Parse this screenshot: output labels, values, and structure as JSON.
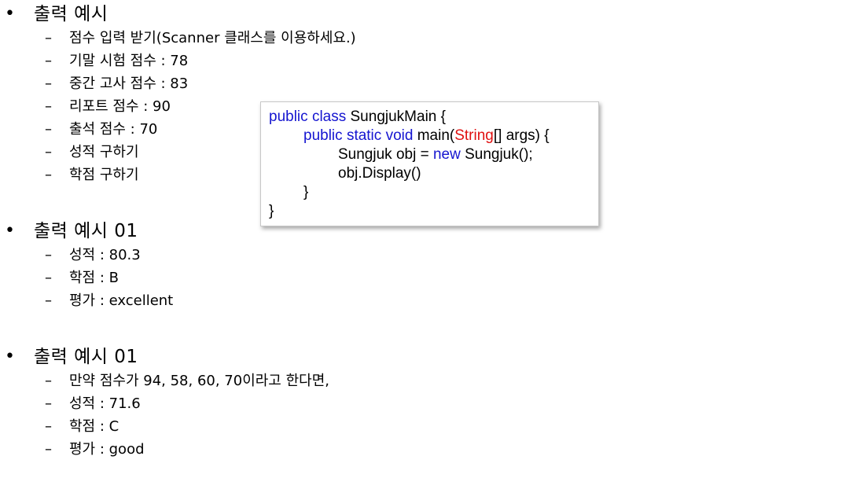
{
  "sections": [
    {
      "heading": "출력 예시",
      "items": [
        "점수 입력 받기(Scanner 클래스를 이용하세요.)",
        "기말 시험 점수 : 78",
        "중간 고사 점수 : 83",
        "리포트 점수 : 90",
        "출석 점수 : 70",
        "성적 구하기",
        "학점 구하기"
      ]
    },
    {
      "heading": "출력 예시 01",
      "items": [
        "성적 : 80.3",
        "학점 : B",
        "평가 : excellent"
      ]
    },
    {
      "heading": "출력 예시 01",
      "items": [
        "만약 점수가 94, 58, 60, 70이라고 한다면,",
        "성적 : 71.6",
        "학점 : C",
        "평가 : good"
      ]
    }
  ],
  "bullet_symbol": "•",
  "dash_symbol": "–",
  "code": {
    "line1_kw1": "public",
    "line1_kw2": "class",
    "line1_rest": " SungjukMain {",
    "line2_kw1": "public",
    "line2_kw2": "static",
    "line2_kw3": "void",
    "line2_mid": " main(",
    "line2_str": "String",
    "line2_rest": "[] args) {",
    "line3_pre": "Sungjuk obj = ",
    "line3_kw": "new",
    "line3_rest": " Sungjuk();",
    "line4": "obj.Display()",
    "line5": "}",
    "line6": "}"
  },
  "colors": {
    "keyword": "#1515d0",
    "string_type": "#e01010",
    "text": "#000000"
  }
}
